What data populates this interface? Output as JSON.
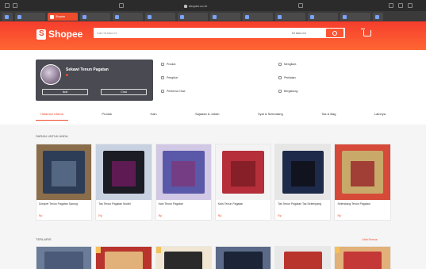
{
  "browser": {
    "url": "shopee.co.id",
    "tabs": [
      "",
      "Shopee",
      "",
      "",
      "",
      "",
      "",
      "",
      "",
      "",
      "",
      "",
      ""
    ],
    "active_tab": 1
  },
  "header": {
    "logo_text": "Shopee",
    "search_placeholder": "Cari di toko ini",
    "search_scope": "Di toko ini",
    "hints": [
      "",
      "",
      "",
      "",
      ""
    ]
  },
  "shop": {
    "name": "Sekawi Tenun Pagatan",
    "subtitle": "",
    "follow_label": "Ikuti",
    "chat_label": "Chat"
  },
  "stats": [
    {
      "label": "Produk:",
      "value": ""
    },
    {
      "label": "Mengikuti:",
      "value": ""
    },
    {
      "label": "Pengikut:",
      "value": ""
    },
    {
      "label": "Penilaian:",
      "value": ""
    },
    {
      "label": "Performa Chat:",
      "value": ""
    },
    {
      "label": "Bergabung:",
      "value": ""
    }
  ],
  "nav": [
    "Halaman Utama",
    "Produk",
    "Kain",
    "Sajadah & Jubah",
    "Syal & Selendang",
    "Tas & Bag",
    "Lainnya"
  ],
  "nav_active": 0,
  "recommend": {
    "title": "SARAN UNTUK ANDA",
    "products": [
      {
        "name": "Dompet Tenun Pagatan Sarung",
        "price": "Rp",
        "colors": [
          "#2e3d57",
          "#5b6e8a",
          "#8a6d4a"
        ]
      },
      {
        "name": "Tas Tenun Pagatan Model",
        "price": "Rp",
        "colors": [
          "#1c1c24",
          "#6a1b5c",
          "#c7d1e0"
        ]
      },
      {
        "name": "Kain Tenun Pagatan",
        "price": "Rp",
        "colors": [
          "#5a58a8",
          "#7a3a7e",
          "#d0c8e4"
        ]
      },
      {
        "name": "Kain Tenun Pagatan",
        "price": "Rp",
        "colors": [
          "#b52e3a",
          "#7e1c24",
          "#f3f3f3"
        ]
      },
      {
        "name": "Tas Tenun Pagatan Tas Selempang",
        "price": "Rp",
        "colors": [
          "#1e2a4a",
          "#0f0f18",
          "#e6e6e6"
        ]
      },
      {
        "name": "Selendang Tenun Pagatan",
        "price": "Rp",
        "colors": [
          "#c8a96a",
          "#9a2c2c",
          "#d64a3a"
        ]
      }
    ]
  },
  "second": {
    "title": "TERLARIS",
    "see_all": "Lihat Semua",
    "products": [
      {
        "colors": [
          "#4a5a78",
          "#6a7c98"
        ]
      },
      {
        "colors": [
          "#e2b079",
          "#b8342c"
        ]
      },
      {
        "colors": [
          "#2a2a2a",
          "#f0e6d2"
        ]
      },
      {
        "colors": [
          "#1c2438",
          "#5a6a88"
        ]
      },
      {
        "colors": [
          "#b8342c",
          "#e8e8e8"
        ]
      },
      {
        "colors": [
          "#c43838",
          "#e2b079"
        ]
      }
    ]
  },
  "colors": {
    "brand": "#ee4d2d",
    "header_top": "#f53d2d",
    "header_bottom": "#ff6633",
    "card_bg": "#4a4a52"
  }
}
